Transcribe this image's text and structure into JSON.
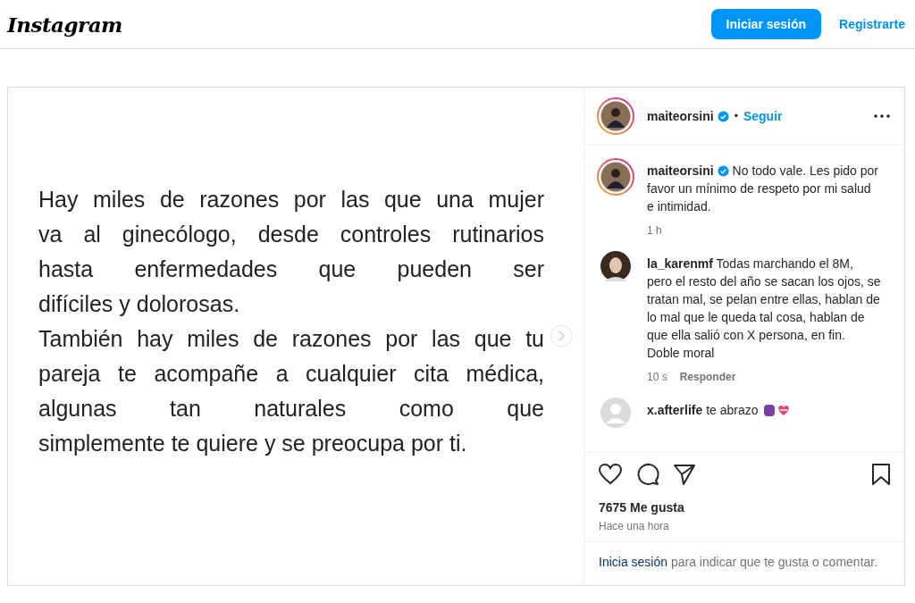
{
  "header": {
    "logo": "Instagram",
    "login_button": "Iniciar sesión",
    "signup_link": "Registrarte"
  },
  "post_image": {
    "paragraphs": [
      [
        "Hay miles de razones por las que una mujer",
        "va al ginecólogo, desde controles rutinarios",
        "hasta enfermedades que pueden ser",
        "difíciles y dolorosas."
      ],
      [
        "También hay miles de razones por las que tu",
        "pareja te acompañe a cualquier cita médica,",
        "algunas tan naturales como que",
        "simplemente te quiere y se preocupa por ti."
      ]
    ]
  },
  "author": {
    "username": "maiteorsini",
    "verified": true,
    "separator": "•",
    "follow": "Seguir"
  },
  "comments": [
    {
      "username": "maiteorsini",
      "verified": true,
      "text": "No todo vale. Les pido por favor un mínimo de respeto por mi salud e intimidad.",
      "time": "1 h",
      "kind": "story"
    },
    {
      "username": "la_karenmf",
      "text": "Todas marchando el 8M, pero el resto del año se sacan los ojos, se tratan mal, se pelan entre ellas, hablan de lo mal que le queda tal cosa, hablan de que ella salió con X persona, en fin. Doble moral",
      "time": "10 s",
      "reply": "Responder",
      "kind": "photo"
    },
    {
      "username": "x.afterlife",
      "text": "te abrazo",
      "emoji": true,
      "kind": "default"
    }
  ],
  "likes": "7675 Me gusta",
  "posted": "Hace una hora",
  "login_prompt": {
    "link": "Inicia sesión",
    "text": "para indicar que te gusta o comentar."
  }
}
